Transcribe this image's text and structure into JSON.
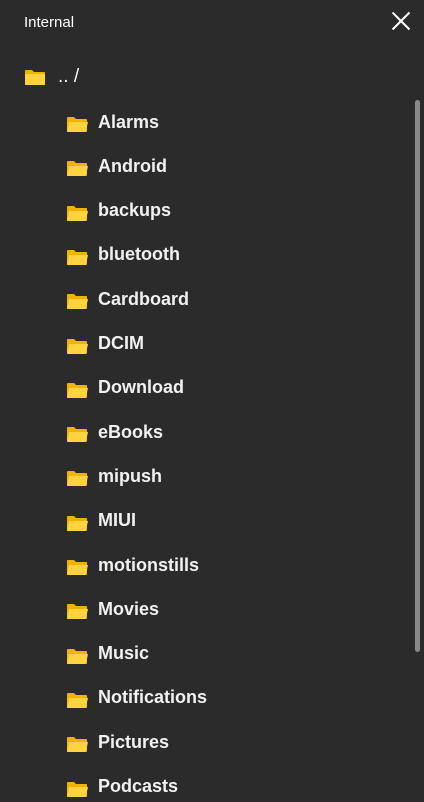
{
  "header": {
    "title": "Internal"
  },
  "parent": {
    "label": ".. /"
  },
  "folders": [
    "Alarms",
    "Android",
    "backups",
    "bluetooth",
    "Cardboard",
    "DCIM",
    "Download",
    "eBooks",
    "mipush",
    "MIUI",
    "motionstills",
    "Movies",
    "Music",
    "Notifications",
    "Pictures",
    "Podcasts"
  ],
  "icons": {
    "folder": "folder-icon",
    "close": "close-icon"
  },
  "colors": {
    "background": "#2b2b2b",
    "folder": "#f5c518",
    "text": "#ffffff"
  }
}
